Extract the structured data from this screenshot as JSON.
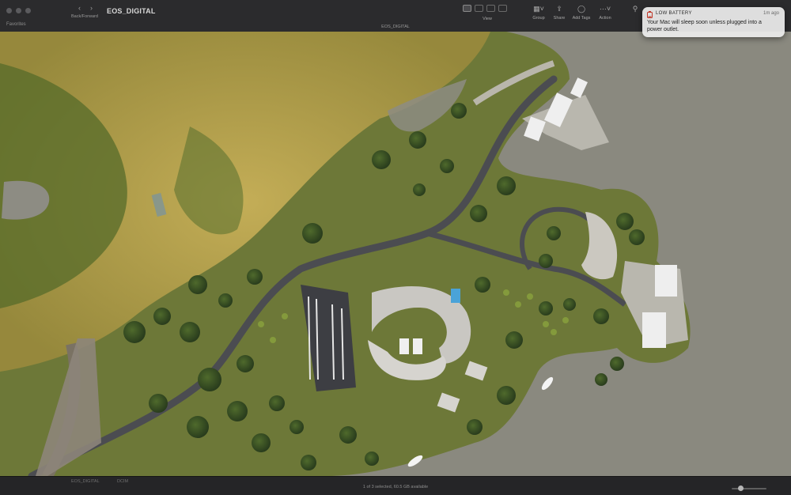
{
  "window": {
    "title": "EOS_DIGITAL",
    "path_title": "EOS_DIGITAL"
  },
  "sidebar": {
    "header": "Favorites"
  },
  "toolbar": {
    "back_forward_label": "Back/Forward",
    "view_label": "View",
    "group_label": "Group",
    "share_label": "Share",
    "add_tags_label": "Add Tags",
    "action_label": "Action"
  },
  "statusbar": {
    "text": "1 of 3 selected, 60.5 GB available",
    "path_items": [
      "EOS_DIGITAL",
      "DCIM"
    ]
  },
  "notification": {
    "title": "LOW BATTERY",
    "time": "1m ago",
    "body": "Your Mac will sleep soon unless plugged into a power outlet.",
    "icon": "battery-icon"
  },
  "colors": {
    "window_bg": "#232325",
    "water": "#8b8a80",
    "grass": "#6f7a3a",
    "road": "#4a4b50",
    "notification_bg": "#ececec"
  }
}
